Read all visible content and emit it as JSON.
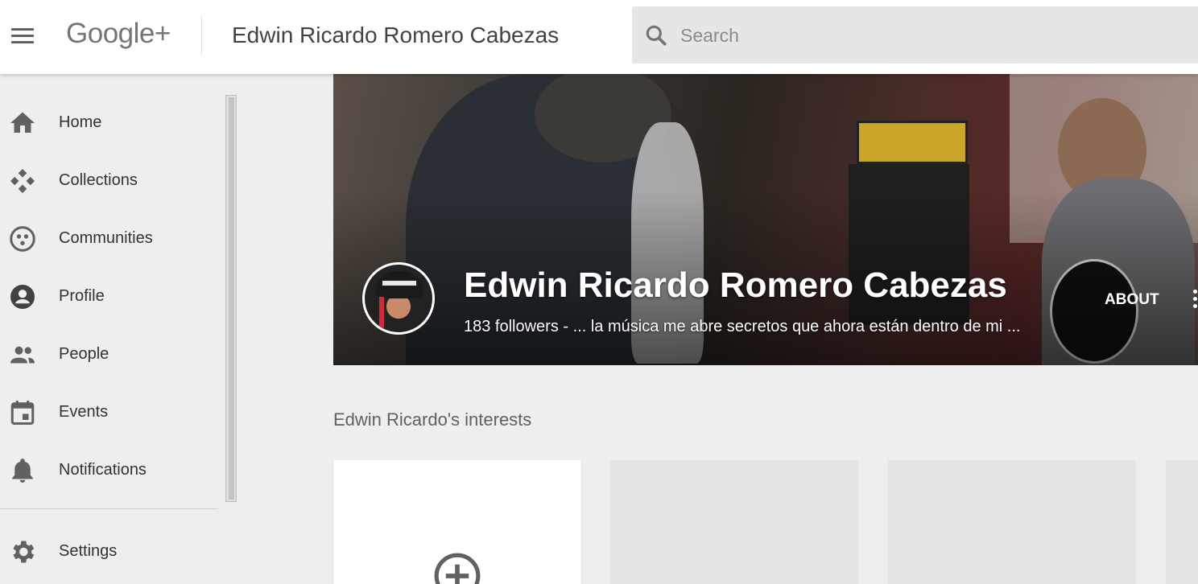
{
  "header": {
    "logo_text": "Google+",
    "title": "Edwin Ricardo Romero Cabezas",
    "search_placeholder": "Search"
  },
  "sidebar": {
    "items": [
      {
        "label": "Home",
        "icon": "home-icon"
      },
      {
        "label": "Collections",
        "icon": "collections-icon"
      },
      {
        "label": "Communities",
        "icon": "communities-icon"
      },
      {
        "label": "Profile",
        "icon": "profile-icon"
      },
      {
        "label": "People",
        "icon": "people-icon"
      },
      {
        "label": "Events",
        "icon": "events-icon"
      },
      {
        "label": "Notifications",
        "icon": "notifications-icon"
      },
      {
        "label": "Settings",
        "icon": "settings-icon"
      }
    ]
  },
  "profile": {
    "name": "Edwin Ricardo Romero Cabezas",
    "subtitle": "183 followers - ... la música me abre secretos que ahora están dentro de mi ...",
    "about_label": "ABOUT"
  },
  "interests": {
    "title": "Edwin Ricardo's interests"
  },
  "colors": {
    "icon_gray": "#616161",
    "background": "#eeeeee",
    "header_bg": "#ffffff"
  }
}
